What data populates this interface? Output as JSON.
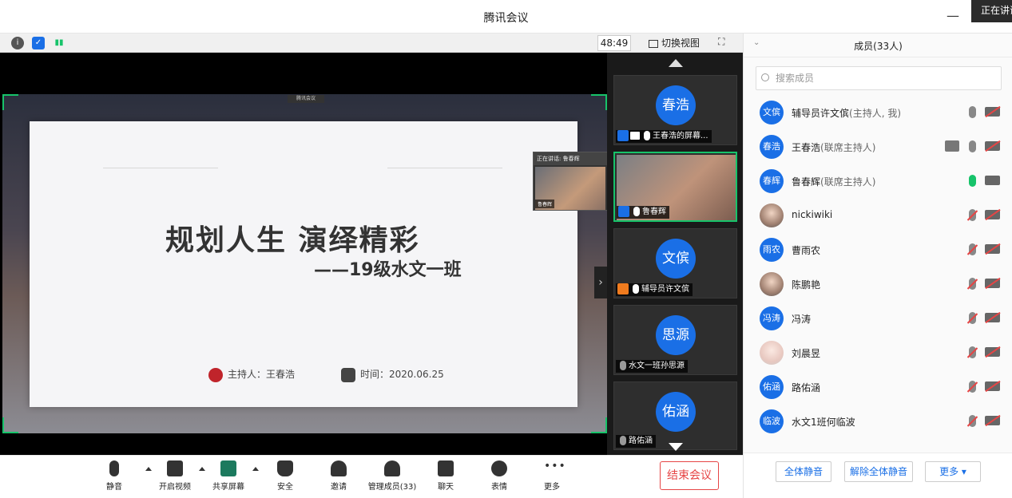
{
  "window": {
    "title": "腾讯会议",
    "minimize": "—",
    "speaking_tag": "正在讲话"
  },
  "video_topbar": {
    "timer": "48:49",
    "switch_view": "切换视图"
  },
  "share": {
    "source_tag": "腾讯会议",
    "slide_title": "规划人生  演绎精彩",
    "slide_subtitle": "——19级水文一班",
    "host_label": "主持人：王春浩",
    "time_label": "时间：2020.06.25",
    "pip_header": "正在讲话: 鲁春辉",
    "pip_name": "鲁春辉"
  },
  "thumbnails": [
    {
      "avatar": "春浩",
      "label": "王春浩的屏幕..."
    },
    {
      "avatar": "",
      "label": "鲁春辉"
    },
    {
      "avatar": "文傧",
      "label": "辅导员许文傧"
    },
    {
      "avatar": "思源",
      "label": "水文一班孙思源"
    },
    {
      "avatar": "佑涵",
      "label": "路佑涵"
    }
  ],
  "toolbar": {
    "mute": "静音",
    "start_video": "开启视频",
    "share_screen": "共享屏幕",
    "security": "安全",
    "invite": "邀请",
    "manage_members": "管理成员(33)",
    "chat": "聊天",
    "reactions": "表情",
    "more": "更多",
    "end_meeting": "结束会议"
  },
  "members": {
    "title": "成员(33人)",
    "search_placeholder": "搜索成员",
    "list": [
      {
        "avatar": "文傧",
        "name": "辅导员许文傧",
        "role": "(主持人, 我)"
      },
      {
        "avatar": "春浩",
        "name": "王春浩",
        "role": "(联席主持人)"
      },
      {
        "avatar": "春辉",
        "name": "鲁春辉",
        "role": "(联席主持人)"
      },
      {
        "avatar": "",
        "name": "nickiwiki",
        "role": ""
      },
      {
        "avatar": "雨农",
        "name": "曹雨农",
        "role": ""
      },
      {
        "avatar": "",
        "name": "陈鹏艳",
        "role": ""
      },
      {
        "avatar": "冯涛",
        "name": "冯涛",
        "role": ""
      },
      {
        "avatar": "",
        "name": "刘晨昱",
        "role": ""
      },
      {
        "avatar": "佑涵",
        "name": "路佑涵",
        "role": ""
      },
      {
        "avatar": "临波",
        "name": "水文1班何临波",
        "role": ""
      }
    ],
    "mute_all": "全体静音",
    "unmute_all": "解除全体静音",
    "more": "更多 ▾"
  },
  "colors": {
    "accent_blue": "#1a6fe6",
    "active_green": "#17c36a",
    "end_red": "#e64545"
  }
}
